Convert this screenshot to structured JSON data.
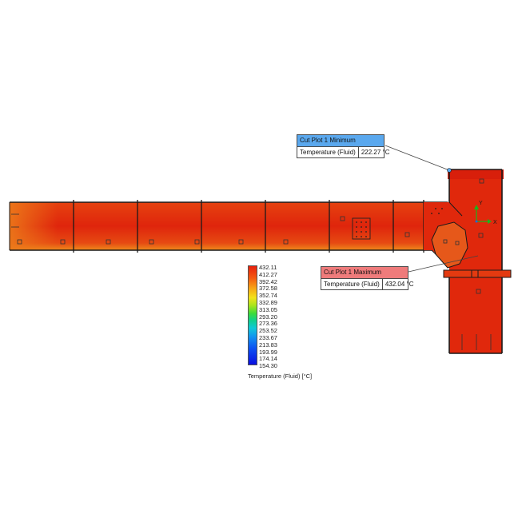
{
  "callouts": {
    "minimum": {
      "title": "Cut Plot 1 Minimum",
      "label": "Temperature (Fluid)",
      "value": "222.27 °C",
      "color": "#5aa8ee"
    },
    "maximum": {
      "title": "Cut Plot 1 Maximum",
      "label": "Temperature (Fluid)",
      "value": "432.04 °C",
      "color": "#ef7b7b"
    }
  },
  "legend": {
    "ticks": [
      "432.11",
      "412.27",
      "392.42",
      "372.58",
      "352.74",
      "332.89",
      "313.05",
      "293.20",
      "273.36",
      "253.52",
      "233.67",
      "213.83",
      "193.99",
      "174.14",
      "154.30"
    ],
    "title": "Temperature (Fluid) [°C]"
  },
  "axes_triad": {
    "x_label": "X",
    "y_label": "Y",
    "x_color": "#1cb41c",
    "y_color": "#1cb41c"
  },
  "plot_colors": {
    "dominant": "#e8300e",
    "hot_core": "#e0200c",
    "warm_edge": "#ec6a18",
    "boundary": "#1a1a1a"
  }
}
